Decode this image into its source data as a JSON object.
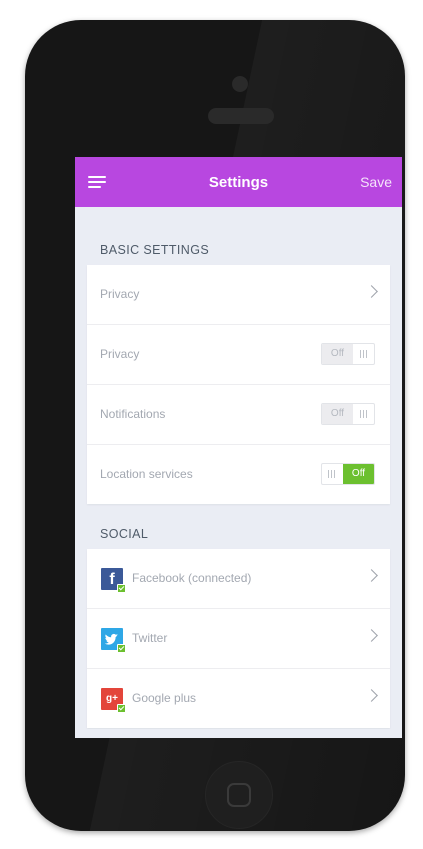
{
  "header": {
    "title": "Settings",
    "save_label": "Save",
    "background": "#b847e0"
  },
  "basic": {
    "title": "BASIC SETTINGS",
    "rows": [
      {
        "label": "Privacy",
        "type": "link"
      },
      {
        "label": "Privacy",
        "type": "toggle",
        "state": "Off"
      },
      {
        "label": "Notifications",
        "type": "toggle",
        "state": "Off"
      },
      {
        "label": "Location services",
        "type": "toggle",
        "state": "Off",
        "highlighted": true
      }
    ]
  },
  "social": {
    "title": "SOCIAL",
    "rows": [
      {
        "label": "Facebook (connected)",
        "icon": "facebook-icon",
        "icon_text": "f"
      },
      {
        "label": "Twitter",
        "icon": "twitter-icon"
      },
      {
        "label": "Google plus",
        "icon": "google-plus-icon",
        "icon_text": "g+"
      }
    ]
  },
  "colors": {
    "accent": "#b847e0",
    "toggle_on": "#6cc02f",
    "facebook": "#3b5998",
    "twitter": "#2ea7e6",
    "google_plus": "#e3453a"
  }
}
